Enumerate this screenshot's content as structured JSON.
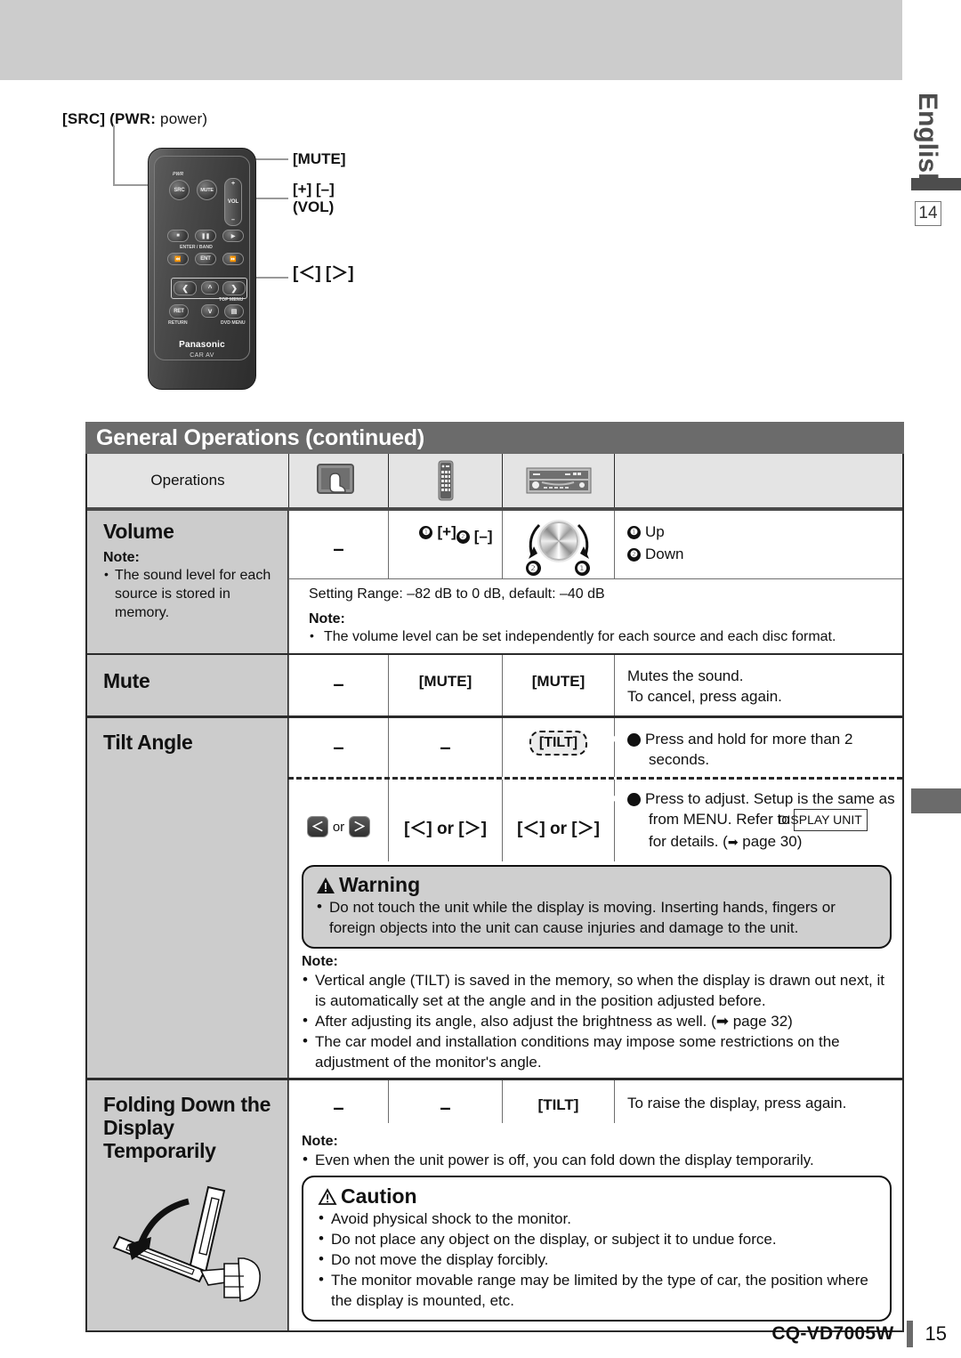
{
  "sidebar": {
    "language": "English",
    "page_marker": "14"
  },
  "remote": {
    "callouts": {
      "src": "[SRC] (PWR:",
      "src_light": " power)",
      "mute": "[MUTE]",
      "vol_line1": "[+] [–]",
      "vol_line2": "(VOL)",
      "leftright": "[＜] [＞]"
    },
    "labels": {
      "pwr": "PWR",
      "src": "SRC",
      "mute": "MUTE",
      "vol": "VOL",
      "plus": "+",
      "minus": "–",
      "enter_band": "ENTER / BAND",
      "ent": "ENT",
      "ret": "RET",
      "return": "RETURN",
      "top_menu": "TOP MENU",
      "dvd_menu": "DVD MENU",
      "brand": "Panasonic",
      "brand_sub": "CAR AV"
    }
  },
  "section": {
    "title": "General Operations (continued)"
  },
  "table": {
    "header": {
      "operations": "Operations",
      "icon_touch": "touch-panel-icon",
      "icon_remote": "remote-control-icon",
      "icon_unit": "head-unit-icon"
    },
    "rows": [
      {
        "title": "Volume",
        "note_label": "Note:",
        "note_bullets": [
          "The sound level for each source is stored in memory."
        ],
        "touch": "–",
        "remote_items": [
          {
            "num": "❶",
            "label": "[+]"
          },
          {
            "num": "❷",
            "label": "[–]"
          }
        ],
        "unit_knob_marks": {
          "left": "❷",
          "right": "❶"
        },
        "desc_items": [
          {
            "num": "❶",
            "label": "Up"
          },
          {
            "num": "❷",
            "label": "Down"
          }
        ],
        "setting_range": "Setting Range: –82 dB to 0 dB,  default: –40 dB",
        "sub_note_label": "Note:",
        "sub_note_bullets": [
          "The volume level can be set independently for each source and each disc format."
        ]
      },
      {
        "title": "Mute",
        "touch": "–",
        "remote": "[MUTE]",
        "unit": "[MUTE]",
        "desc_lines": [
          "Mutes the sound.",
          "To cancel, press again."
        ]
      },
      {
        "title": "Tilt Angle",
        "step1": {
          "touch": "–",
          "remote": "–",
          "unit": "[TILT]",
          "num": "❶",
          "desc": "Press and hold for more than 2 seconds."
        },
        "step2": {
          "touch_keys": {
            "left": "＜",
            "or": "or",
            "right": "＞"
          },
          "remote": "[＜] or [＞]",
          "unit": "[＜] or [＞]",
          "num": "❷",
          "desc_part1": "Press to adjust. Setup is the same as from MENU. Refer to ",
          "desc_boxref": "DISPLAY UNIT",
          "desc_part2": "for details. (",
          "desc_page": " page 30)"
        },
        "warning": {
          "title": "Warning",
          "bullets": [
            "Do not touch the unit while the display is moving. Inserting hands, fingers or foreign objects into the unit can cause injuries and damage to the unit."
          ]
        },
        "note_label": "Note:",
        "note_bullets": [
          "Vertical angle (TILT) is saved in the memory, so when the display is drawn out next, it is automatically set at the angle and in the position adjusted before.",
          "After adjusting its angle, also adjust the brightness as well. (➡ page 32)",
          "The car model and installation conditions may impose some restrictions on the adjustment of the monitor's angle."
        ]
      },
      {
        "title_lines": [
          "Folding Down the",
          "Display",
          "Temporarily"
        ],
        "touch": "–",
        "remote": "–",
        "unit": "[TILT]",
        "desc": "To raise the display, press again.",
        "note_label": "Note:",
        "note_bullets": [
          "Even when the unit power is off, you can fold down the display temporarily."
        ],
        "caution": {
          "title": "Caution",
          "bullets": [
            "Avoid physical shock to the monitor.",
            "Do not place any object on the display, or subject it to undue force.",
            "Do not move the display forcibly.",
            "The monitor movable range may be limited by the type of car, the position where the display is mounted, etc."
          ]
        }
      }
    ]
  },
  "footer": {
    "model": "CQ-VD7005W",
    "page": "15"
  },
  "colors": {
    "band_gray": "#cccccc",
    "title_bar": "#6b6b6b",
    "header_gray": "#e4e4e4",
    "warning_bg": "#cfcfcf"
  }
}
